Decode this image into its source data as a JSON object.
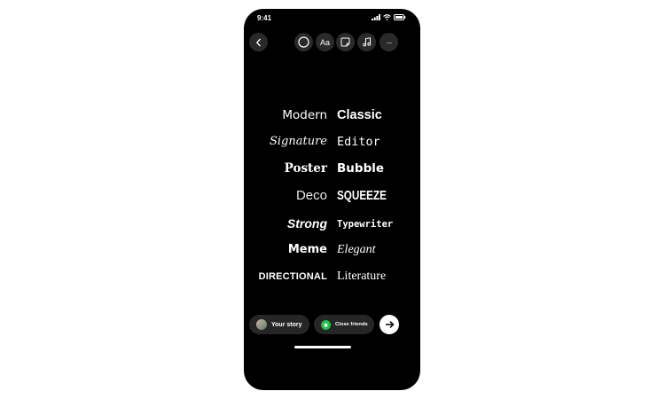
{
  "status_bar": {
    "time": "9:41"
  },
  "toolbar": {
    "back_icon": "chevron-left-icon",
    "circle_icon": "circle-icon",
    "text_label": "Aa",
    "sticker_icon": "sticker-icon",
    "music_icon": "music-icon",
    "more_label": "···"
  },
  "fonts": [
    {
      "left": "Modern",
      "right": "Classic"
    },
    {
      "left": "Signature",
      "right": "Editor"
    },
    {
      "left": "Poster",
      "right": "Bubble"
    },
    {
      "left": "Deco",
      "right": "SQUEEZE"
    },
    {
      "left": "Strong",
      "right": "Typewriter"
    },
    {
      "left": "Meme",
      "right": "Elegant"
    },
    {
      "left": "DIRECTIONAL",
      "right": "Literature"
    }
  ],
  "share": {
    "your_story": "Your story",
    "close_friends": "Close friends",
    "close_friends_color": "#1fbf4b"
  }
}
